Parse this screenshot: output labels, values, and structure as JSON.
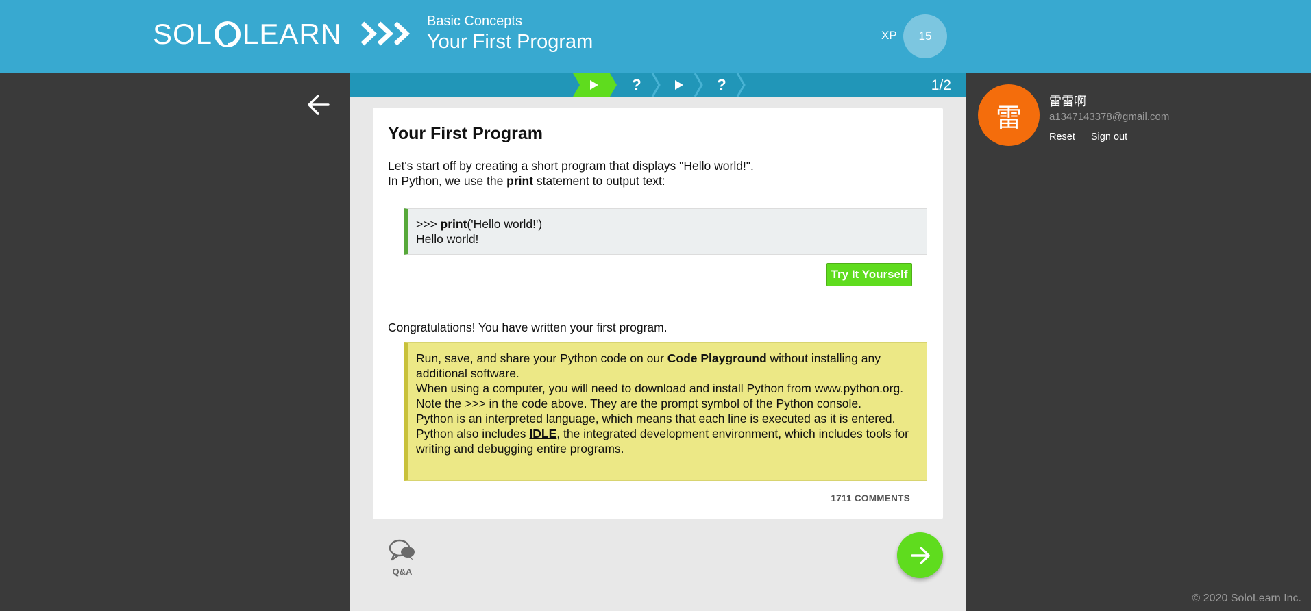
{
  "header": {
    "logo_left": "SOL",
    "logo_right": "LEARN",
    "course_section": "Basic Concepts",
    "lesson_title": "Your First Program",
    "xp_label": "XP",
    "xp_value": "15",
    "brand_color": "#38a9d0"
  },
  "progress": {
    "steps": [
      {
        "icon": "play-icon",
        "state": "active"
      },
      {
        "icon": "question-icon",
        "state": "pending"
      },
      {
        "icon": "play-icon",
        "state": "pending"
      },
      {
        "icon": "question-icon",
        "state": "pending"
      }
    ],
    "count": "1/2"
  },
  "lesson": {
    "title": "Your First Program",
    "intro_line1": "Let's start off by creating a short program that displays \"Hello world!\".",
    "intro_line2_pre": "In Python, we use the ",
    "intro_line2_bold": "print",
    "intro_line2_post": " statement to output text:",
    "code_prompt": ">>> ",
    "code_func": "print",
    "code_args": "('Hello world!')",
    "code_output": "Hello world!",
    "try_button": "Try It Yourself",
    "congrats": "Congratulations! You have written your first program.",
    "note_p1_pre": "Run, save, and share your Python code on our ",
    "note_p1_bold": "Code Playground",
    "note_p1_post": " without installing any additional software.",
    "note_p2": "When using a computer, you will need to download and install Python from www.python.org.",
    "note_p3": "Note the >>> in the code above. They are the prompt symbol of the Python console.",
    "note_p4_pre": "Python is an interpreted language, which means that each line is executed as it is entered. Python also includes ",
    "note_p4_link": "IDLE",
    "note_p4_post": ", the integrated development environment, which includes tools for writing and debugging entire programs.",
    "comments": "1711 COMMENTS"
  },
  "actions": {
    "qa_label": "Q&A"
  },
  "user": {
    "avatar_char": "雷",
    "name": "雷雷啊",
    "email": "a1347143378@gmail.com",
    "reset": "Reset",
    "sign_out": "Sign out",
    "avatar_color": "#f46d0c"
  },
  "footer": {
    "copyright": "© 2020 SoloLearn Inc."
  }
}
